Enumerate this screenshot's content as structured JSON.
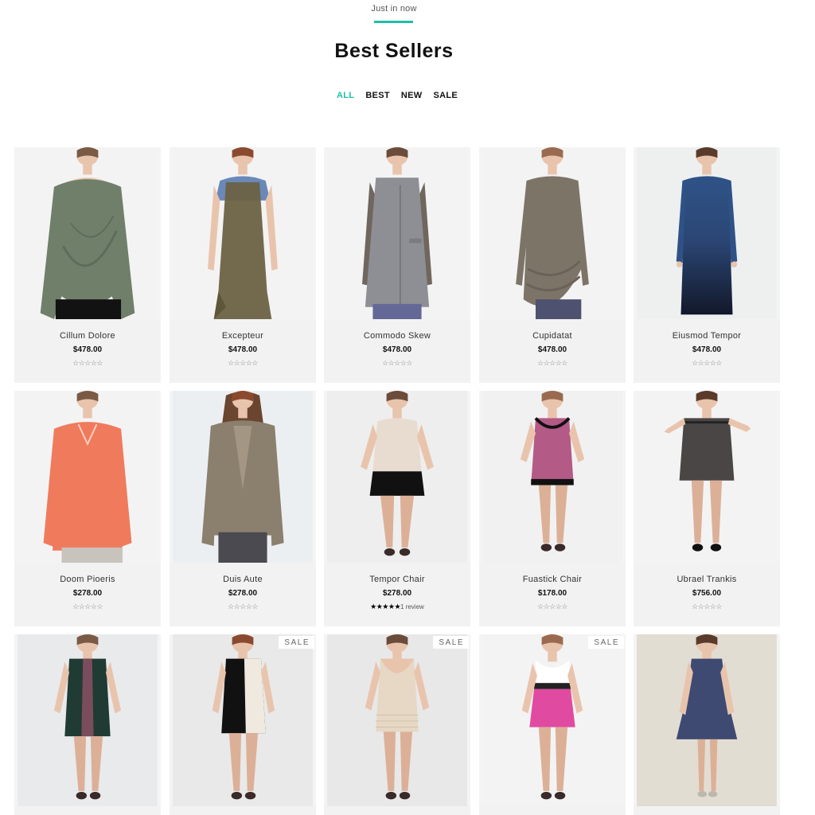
{
  "section": {
    "eyebrow": "Just in now",
    "title": "Best Sellers",
    "accent_color": "#1fbfa8"
  },
  "filters": [
    {
      "label": "ALL",
      "active": true
    },
    {
      "label": "BEST",
      "active": false
    },
    {
      "label": "NEW",
      "active": false
    },
    {
      "label": "SALE",
      "active": false
    }
  ],
  "products": [
    {
      "name": "Cillum Dolore",
      "price": "$478.00",
      "rating": 0,
      "review_text": "",
      "sale": false,
      "outfit": "drape-top",
      "color": "#6f7f6a",
      "bg": "#f3f3f3"
    },
    {
      "name": "Excepteur",
      "price": "$478.00",
      "rating": 0,
      "review_text": "",
      "sale": false,
      "outfit": "tunic",
      "color": "#6b6244",
      "bg": "#f3f3f3"
    },
    {
      "name": "Commodo Skew",
      "price": "$478.00",
      "rating": 0,
      "review_text": "",
      "sale": false,
      "outfit": "vest-coat",
      "color": "#8e8f95",
      "bg": "#f3f3f3"
    },
    {
      "name": "Cupidatat",
      "price": "$478.00",
      "rating": 0,
      "review_text": "",
      "sale": false,
      "outfit": "ruched-dress",
      "color": "#7d7468",
      "bg": "#f3f3f3"
    },
    {
      "name": "Eiusmod Tempor",
      "price": "$478.00",
      "rating": 0,
      "review_text": "",
      "sale": false,
      "outfit": "ombre-dress",
      "color": "#2d4a78",
      "bg": "#eef0f0"
    },
    {
      "name": "Doom Pioeris",
      "price": "$278.00",
      "rating": 0,
      "review_text": "",
      "sale": false,
      "outfit": "coral-top",
      "color": "#f07a5c",
      "bg": "#f3f3f3"
    },
    {
      "name": "Duis Aute",
      "price": "$278.00",
      "rating": 0,
      "review_text": "",
      "sale": false,
      "outfit": "jacket",
      "color": "#8b7f6e",
      "bg": "#eceff2"
    },
    {
      "name": "Tempor Chair",
      "price": "$278.00",
      "rating": 5,
      "review_text": "1 review",
      "sale": false,
      "outfit": "blouse-skirt",
      "color": "#e8dcd0",
      "bg": "#eeeeee"
    },
    {
      "name": "Fuastick Chair",
      "price": "$178.00",
      "rating": 0,
      "review_text": "",
      "sale": false,
      "outfit": "pink-dress",
      "color": "#b35a86",
      "bg": "#f1f1f1"
    },
    {
      "name": "Ubrael Trankis",
      "price": "$756.00",
      "rating": 0,
      "review_text": "",
      "sale": false,
      "outfit": "tweed-dress",
      "color": "#4a4646",
      "bg": "#f3f3f3"
    },
    {
      "name": "",
      "price": "",
      "rating": 0,
      "review_text": "",
      "sale": false,
      "outfit": "green-sheath",
      "color": "#1f3b34",
      "bg": "#e9eaec"
    },
    {
      "name": "",
      "price": "",
      "rating": 0,
      "review_text": "",
      "sale": true,
      "sale_label": "SALE",
      "outfit": "bw-dress",
      "color": "#111111",
      "bg": "#e9e9e9"
    },
    {
      "name": "",
      "price": "",
      "rating": 0,
      "review_text": "",
      "sale": true,
      "sale_label": "SALE",
      "outfit": "cream-dress",
      "color": "#e6d8c4",
      "bg": "#e8e8e8"
    },
    {
      "name": "",
      "price": "",
      "rating": 0,
      "review_text": "",
      "sale": true,
      "sale_label": "SALE",
      "outfit": "pink-collar-dress",
      "color": "#e04aa0",
      "bg": "#f3f3f3"
    },
    {
      "name": "",
      "price": "",
      "rating": 0,
      "review_text": "",
      "sale": false,
      "outfit": "navy-dress",
      "color": "#3e4a72",
      "bg": "#e2ddd2"
    }
  ]
}
